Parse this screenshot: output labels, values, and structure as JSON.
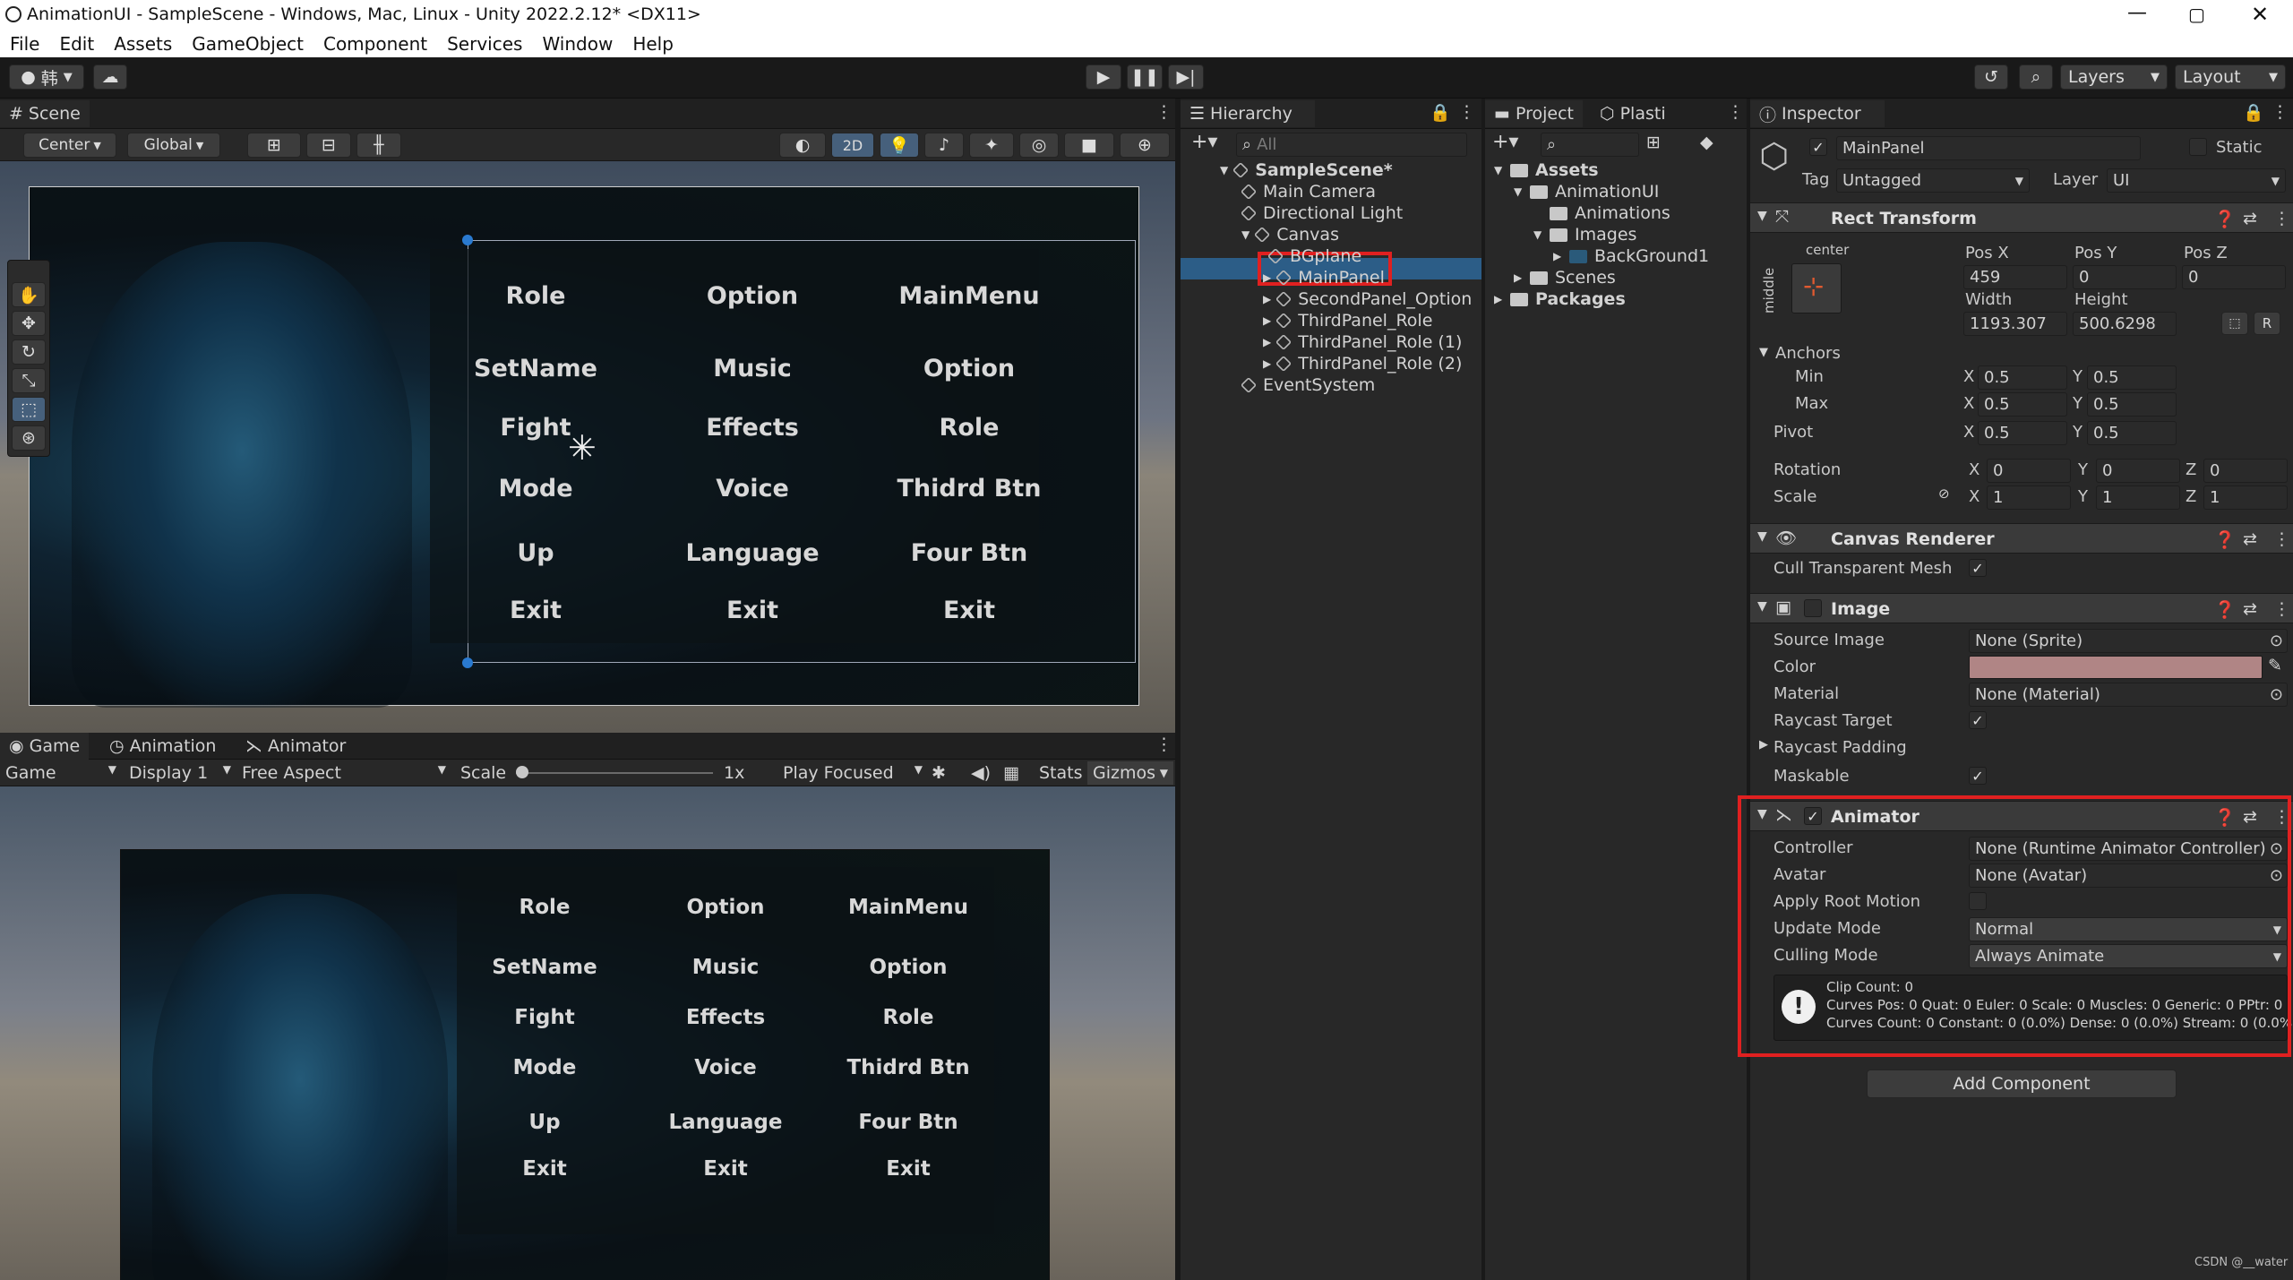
{
  "window": {
    "title": "AnimationUI - SampleScene - Windows, Mac, Linux - Unity 2022.2.12* <DX11>"
  },
  "menu": [
    "File",
    "Edit",
    "Assets",
    "GameObject",
    "Component",
    "Services",
    "Window",
    "Help"
  ],
  "toolbar": {
    "account": "韩",
    "layers": "Layers",
    "layout": "Layout"
  },
  "scene": {
    "tab": "Scene",
    "pivot": "Center",
    "space": "Global",
    "mode2d": "2D"
  },
  "ui_columns": [
    [
      "Role",
      "SetName",
      "Fight",
      "Mode",
      "Up",
      "Exit"
    ],
    [
      "Option",
      "Music",
      "Effects",
      "Voice",
      "Language",
      "Exit"
    ],
    [
      "MainMenu",
      "Option",
      "Role",
      "Thidrd Btn",
      "Four Btn",
      "Exit"
    ]
  ],
  "game": {
    "tabs": [
      "Game",
      "Animation",
      "Animator"
    ],
    "mode": "Game",
    "display": "Display 1",
    "aspect": "Free Aspect",
    "scale_label": "Scale",
    "scale_value": "1x",
    "play": "Play Focused",
    "stats": "Stats",
    "gizmos": "Gizmos"
  },
  "hierarchy": {
    "tab": "Hierarchy",
    "search": "All",
    "items": [
      {
        "label": "SampleScene*",
        "depth": 0
      },
      {
        "label": "Main Camera",
        "depth": 1
      },
      {
        "label": "Directional Light",
        "depth": 1
      },
      {
        "label": "Canvas",
        "depth": 1
      },
      {
        "label": "BGplane",
        "depth": 2
      },
      {
        "label": "MainPanel",
        "depth": 2
      },
      {
        "label": "SecondPanel_Option",
        "depth": 2
      },
      {
        "label": "ThirdPanel_Role",
        "depth": 2
      },
      {
        "label": "ThirdPanel_Role (1)",
        "depth": 2
      },
      {
        "label": "ThirdPanel_Role (2)",
        "depth": 2
      },
      {
        "label": "EventSystem",
        "depth": 1
      }
    ]
  },
  "project": {
    "tabs": [
      "Project",
      "Plasti"
    ],
    "items": [
      {
        "label": "Assets",
        "depth": 0
      },
      {
        "label": "AnimationUI",
        "depth": 1
      },
      {
        "label": "Animations",
        "depth": 2
      },
      {
        "label": "Images",
        "depth": 2
      },
      {
        "label": "BackGround1",
        "depth": 3
      },
      {
        "label": "Scenes",
        "depth": 1
      },
      {
        "label": "Packages",
        "depth": 0
      }
    ]
  },
  "inspector": {
    "tab": "Inspector",
    "name": "MainPanel",
    "static": "Static",
    "tag_label": "Tag",
    "tag": "Untagged",
    "layer_label": "Layer",
    "layer": "UI",
    "rect": {
      "title": "Rect Transform",
      "anchor_h": "center",
      "anchor_v": "middle",
      "posx_label": "Pos X",
      "posy_label": "Pos Y",
      "posz_label": "Pos Z",
      "posx": "459",
      "posy": "0",
      "posz": "0",
      "width_label": "Width",
      "height_label": "Height",
      "width": "1193.307",
      "height": "500.6298",
      "anchors": "Anchors",
      "min": "Min",
      "max": "Max",
      "pivot": "Pivot",
      "min_x": "0.5",
      "min_y": "0.5",
      "max_x": "0.5",
      "max_y": "0.5",
      "pivot_x": "0.5",
      "pivot_y": "0.5",
      "rotation": "Rotation",
      "rot_x": "0",
      "rot_y": "0",
      "rot_z": "0",
      "scale": "Scale",
      "scale_x": "1",
      "scale_y": "1",
      "scale_z": "1",
      "x": "X",
      "y": "Y",
      "z": "Z",
      "r": "R"
    },
    "canvas_renderer": {
      "title": "Canvas Renderer",
      "cull": "Cull Transparent Mesh"
    },
    "image": {
      "title": "Image",
      "source_label": "Source Image",
      "source": "None (Sprite)",
      "color_label": "Color",
      "color": "#b08585",
      "material_label": "Material",
      "material": "None (Material)",
      "raycast_label": "Raycast Target",
      "padding_label": "Raycast Padding",
      "maskable_label": "Maskable"
    },
    "animator": {
      "title": "Animator",
      "controller_label": "Controller",
      "controller": "None (Runtime Animator Controller)",
      "avatar_label": "Avatar",
      "avatar": "None (Avatar)",
      "root_label": "Apply Root Motion",
      "update_label": "Update Mode",
      "update": "Normal",
      "culling_label": "Culling Mode",
      "culling": "Always Animate",
      "info1": "Clip Count: 0",
      "info2": "Curves Pos: 0 Quat: 0 Euler: 0 Scale: 0 Muscles: 0 Generic: 0 PPtr: 0",
      "info3": "Curves Count: 0 Constant: 0 (0.0%) Dense: 0 (0.0%) Stream: 0 (0.0%)"
    },
    "add_component": "Add Component"
  },
  "watermark": "CSDN @__water"
}
